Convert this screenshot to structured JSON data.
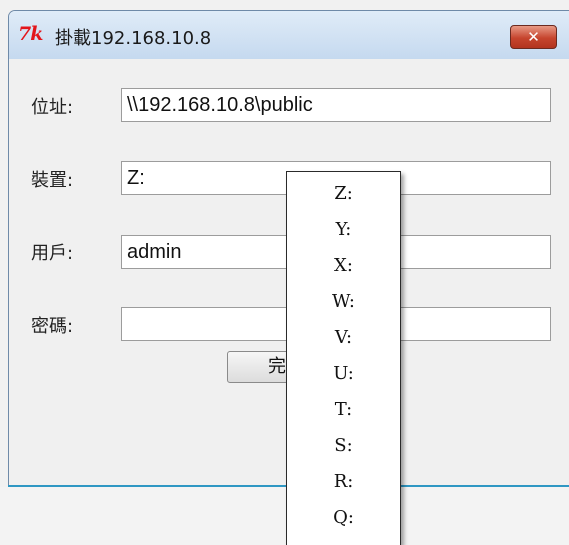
{
  "window": {
    "title": "掛載192.168.10.8",
    "logo_text": "7k",
    "close_symbol": "✕"
  },
  "form": {
    "address_label": "位址:",
    "address_value": "\\\\192.168.10.8\\public",
    "device_label": "裝置:",
    "device_value": "Z:",
    "user_label": "用戶:",
    "user_value": "admin",
    "password_label": "密碼:",
    "password_value": ""
  },
  "ok_button": {
    "label": "完"
  },
  "drive_list": {
    "items": [
      "Z:",
      "Y:",
      "X:",
      "W:",
      "V:",
      "U:",
      "T:",
      "S:",
      "R:",
      "Q:"
    ]
  },
  "colors": {
    "logo": "#e3151b",
    "close_button": "#c6452e",
    "accent_line": "#2f97c3"
  }
}
